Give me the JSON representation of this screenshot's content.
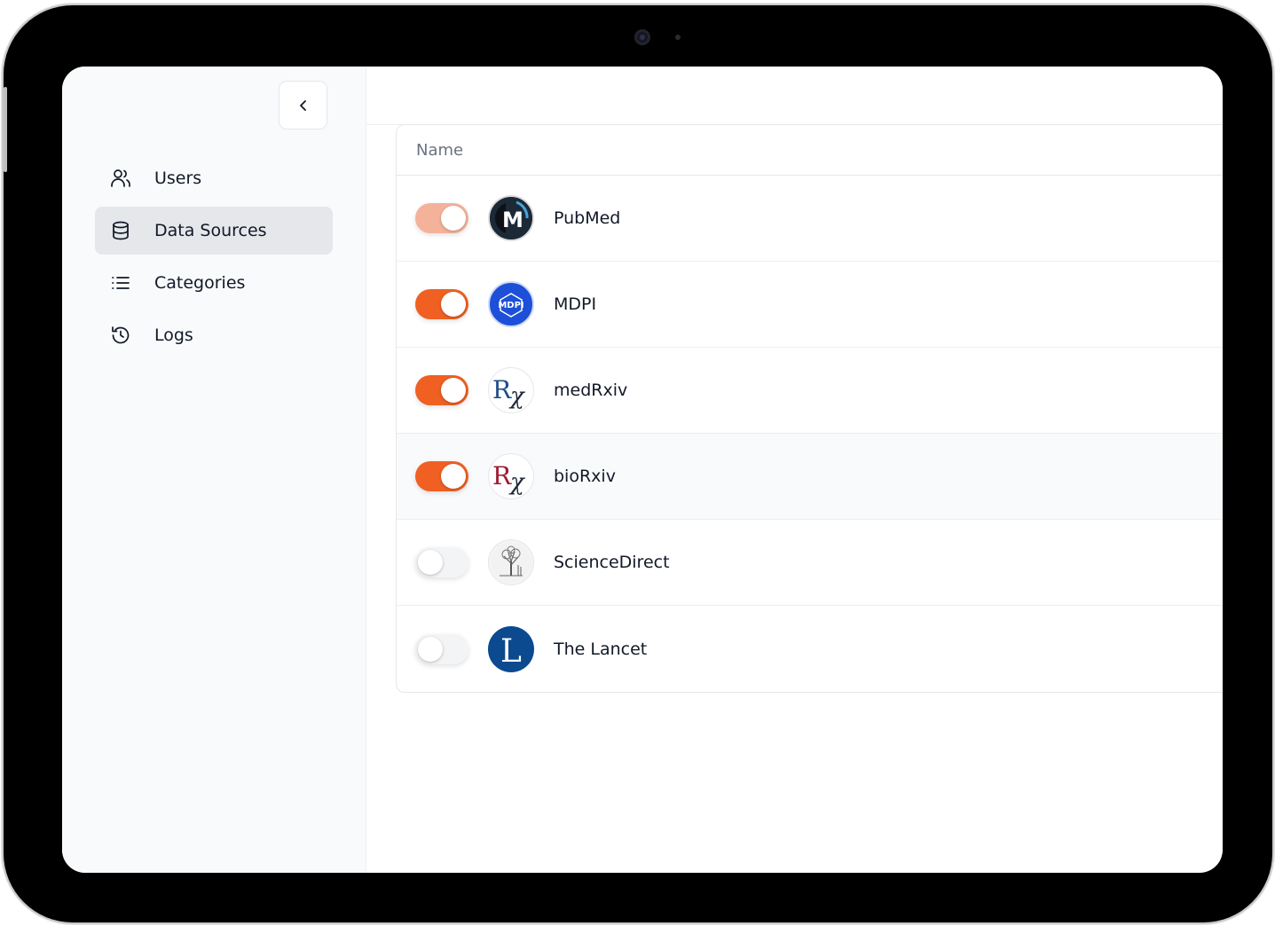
{
  "sidebar": {
    "collapse_icon": "chevron-left-icon",
    "items": [
      {
        "label": "Users",
        "icon": "users-icon",
        "active": false
      },
      {
        "label": "Data Sources",
        "icon": "database-icon",
        "active": true
      },
      {
        "label": "Categories",
        "icon": "list-icon",
        "active": false
      },
      {
        "label": "Logs",
        "icon": "history-icon",
        "active": false
      }
    ]
  },
  "table": {
    "header": "Name",
    "rows": [
      {
        "name": "PubMed",
        "enabled": true,
        "logo": "pubmed-logo",
        "logo_text": "M"
      },
      {
        "name": "MDPI",
        "enabled": true,
        "logo": "mdpi-logo",
        "logo_text": "MDPI"
      },
      {
        "name": "medRxiv",
        "enabled": true,
        "logo": "medrxiv-logo",
        "logo_text": "Rx"
      },
      {
        "name": "bioRxiv",
        "enabled": true,
        "logo": "biorxiv-logo",
        "logo_text": "Rx"
      },
      {
        "name": "ScienceDirect",
        "enabled": false,
        "logo": "sciencedirect-logo",
        "logo_text": ""
      },
      {
        "name": "The Lancet",
        "enabled": false,
        "logo": "lancet-logo",
        "logo_text": "L"
      }
    ]
  },
  "colors": {
    "toggle_on": "#ef6022",
    "toggle_on_faded": "#f5b29a",
    "toggle_off": "#f3f4f6",
    "active_nav_bg": "#e5e7eb"
  }
}
